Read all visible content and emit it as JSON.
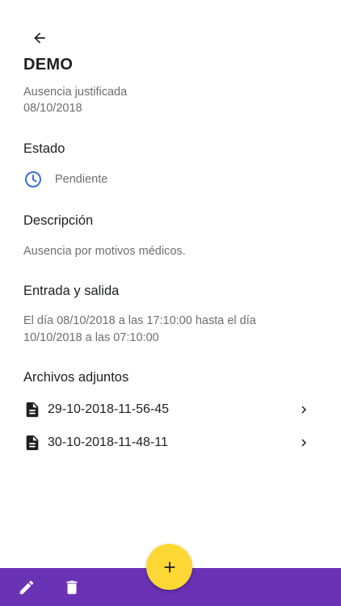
{
  "header": {
    "back_icon": "arrow-left-icon",
    "title": "DEMO"
  },
  "absence": {
    "type": "Ausencia justificada",
    "date": "08/10/2018"
  },
  "status": {
    "heading": "Estado",
    "icon": "clock-icon",
    "icon_color": "#3b6fd4",
    "value": "Pendiente"
  },
  "description": {
    "heading": "Descripción",
    "text": "Ausencia por motivos médicos."
  },
  "entry_exit": {
    "heading": "Entrada y salida",
    "text": "El día 08/10/2018 a las 17:10:00 hasta el día 10/10/2018 a las 07:10:00"
  },
  "attachments": {
    "heading": "Archivos adjuntos",
    "files": [
      {
        "name": "29-10-2018-11-56-45",
        "icon": "file-icon"
      },
      {
        "name": "30-10-2018-11-48-11",
        "icon": "file-icon"
      }
    ]
  },
  "bottom_bar": {
    "color": "#6a32b5",
    "edit_icon": "pencil-icon",
    "delete_icon": "trash-icon"
  },
  "fab": {
    "color": "#fdd835",
    "icon": "plus-icon"
  }
}
